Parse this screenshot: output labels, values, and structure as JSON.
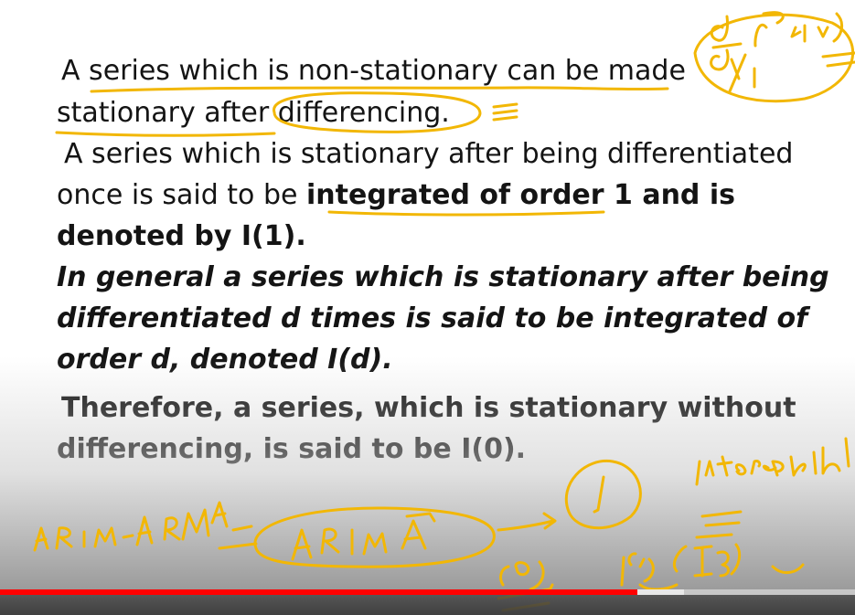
{
  "slide": {
    "line1": "A series which is non-stationary can be made",
    "line2": "stationary after differencing.",
    "line3": "A series which is stationary after being differentiated",
    "line4_regular": "once is said to be ",
    "line4_bold": "integrated of order 1 and is",
    "line5": "denoted by I(1).",
    "line6": "In general a series which is stationary after being",
    "line7": "differentiated d times is said to be integrated of",
    "line8": "order d, denoted I(d).",
    "line9": "Therefore, a series, which is stationary without",
    "line10": "differencing, is said to be I(0)."
  },
  "player": {
    "progress": 0.745,
    "buffered": 0.8,
    "accent_color": "#ff0000"
  },
  "colors": {
    "ink": "#f2b705",
    "text": "#141414"
  }
}
